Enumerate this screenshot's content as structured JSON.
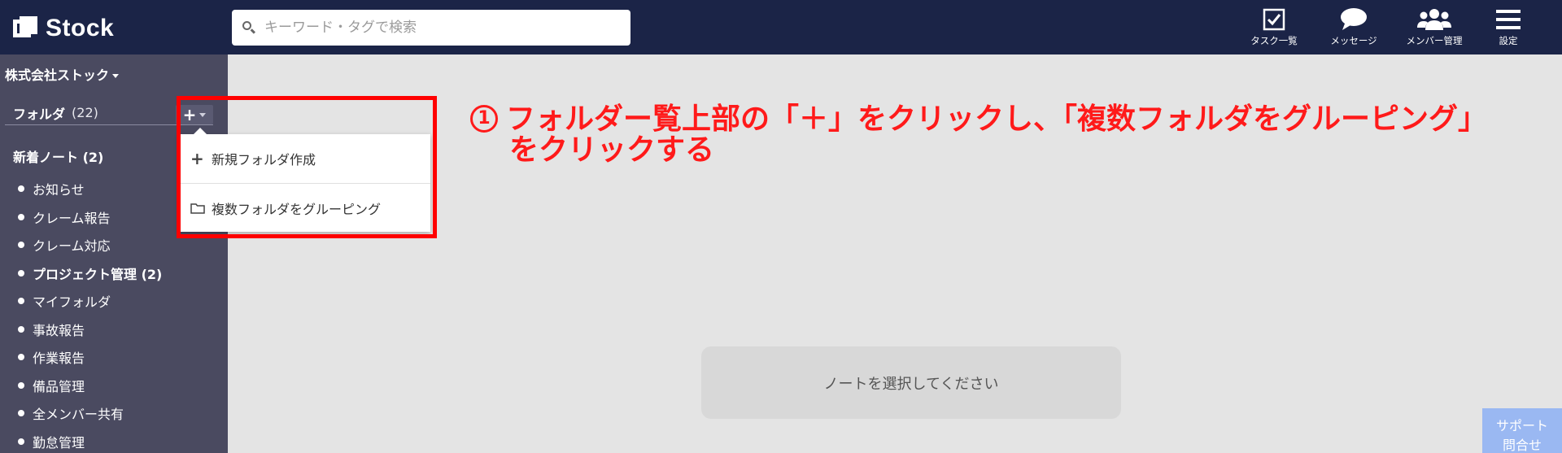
{
  "app": {
    "logo_text": "Stock"
  },
  "search": {
    "placeholder": "キーワード・タグで検索",
    "value": ""
  },
  "nav": {
    "items": [
      {
        "label": "タスク一覧",
        "icon": "checkbox-icon"
      },
      {
        "label": "メッセージ",
        "icon": "chat-bubble-icon"
      },
      {
        "label": "メンバー管理",
        "icon": "users-icon"
      },
      {
        "label": "設定",
        "icon": "menu-icon"
      }
    ]
  },
  "sidebar": {
    "company": "株式会社ストック",
    "folder_title": "フォルダ",
    "folder_count": "(22)",
    "new_notes": "新着ノート (2)",
    "folders": [
      {
        "label": "お知らせ"
      },
      {
        "label": "クレーム報告"
      },
      {
        "label": "クレーム対応"
      },
      {
        "label": "プロジェクト管理 (2)"
      },
      {
        "label": "マイフォルダ"
      },
      {
        "label": "事故報告"
      },
      {
        "label": "作業報告"
      },
      {
        "label": "備品管理"
      },
      {
        "label": "全メンバー共有"
      },
      {
        "label": "勤怠管理"
      }
    ]
  },
  "dropdown": {
    "create_folder": "新規フォルダ作成",
    "group_folders": "複数フォルダをグルーピング"
  },
  "main": {
    "empty_message": "ノートを選択してください",
    "support_label": "サポート\n問合せ"
  },
  "annotation": {
    "number": "1",
    "line1": "フォルダー覧上部の「＋」をクリックし、「複数フォルダをグルーピング」",
    "line2": "をクリックする",
    "color": "#ff1a1a"
  },
  "colors": {
    "topbar": "#1b2447",
    "sidebar": "#4a4a60",
    "main_bg": "#e4e4e4",
    "highlight": "#ff0000",
    "support": "#9ab8f2"
  }
}
